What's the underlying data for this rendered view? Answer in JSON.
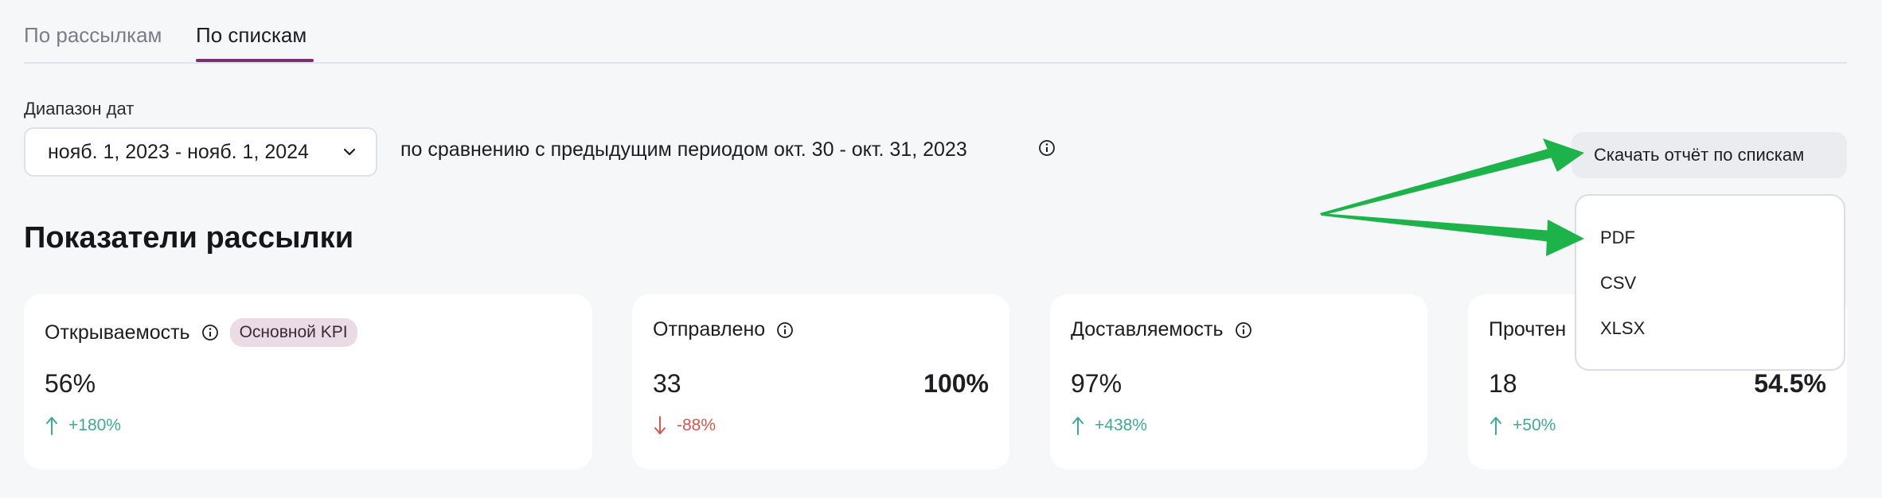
{
  "tabs": [
    {
      "label": "По рассылкам",
      "active": false
    },
    {
      "label": "По спискам",
      "active": true
    }
  ],
  "filters": {
    "date_label": "Диапазон дат",
    "date_value": "нояб. 1, 2023 - нояб. 1, 2024",
    "compare_text": "по сравнению с предыдущим периодом окт. 30 - окт. 31, 2023"
  },
  "download": {
    "button_label": "Скачать отчёт по спискам",
    "options": [
      "PDF",
      "CSV",
      "XLSX"
    ]
  },
  "section": {
    "title": "Показатели рассылки"
  },
  "cards": [
    {
      "title": "Открываемость",
      "badge": "Основной KPI",
      "value": "56%",
      "delta": "+180%",
      "direction": "up"
    },
    {
      "title": "Отправлено",
      "value": "33",
      "secondary": "100%",
      "delta": "-88%",
      "direction": "down"
    },
    {
      "title": "Доставляемость",
      "value": "97%",
      "delta": "+438%",
      "direction": "up"
    },
    {
      "title": "Прочтен",
      "value": "18",
      "secondary": "54.5%",
      "delta": "+50%",
      "direction": "up"
    }
  ],
  "colors": {
    "accent": "#7a2e73",
    "up": "#3fa896",
    "down": "#d2574e",
    "annotation_arrow": "#1db34a"
  }
}
